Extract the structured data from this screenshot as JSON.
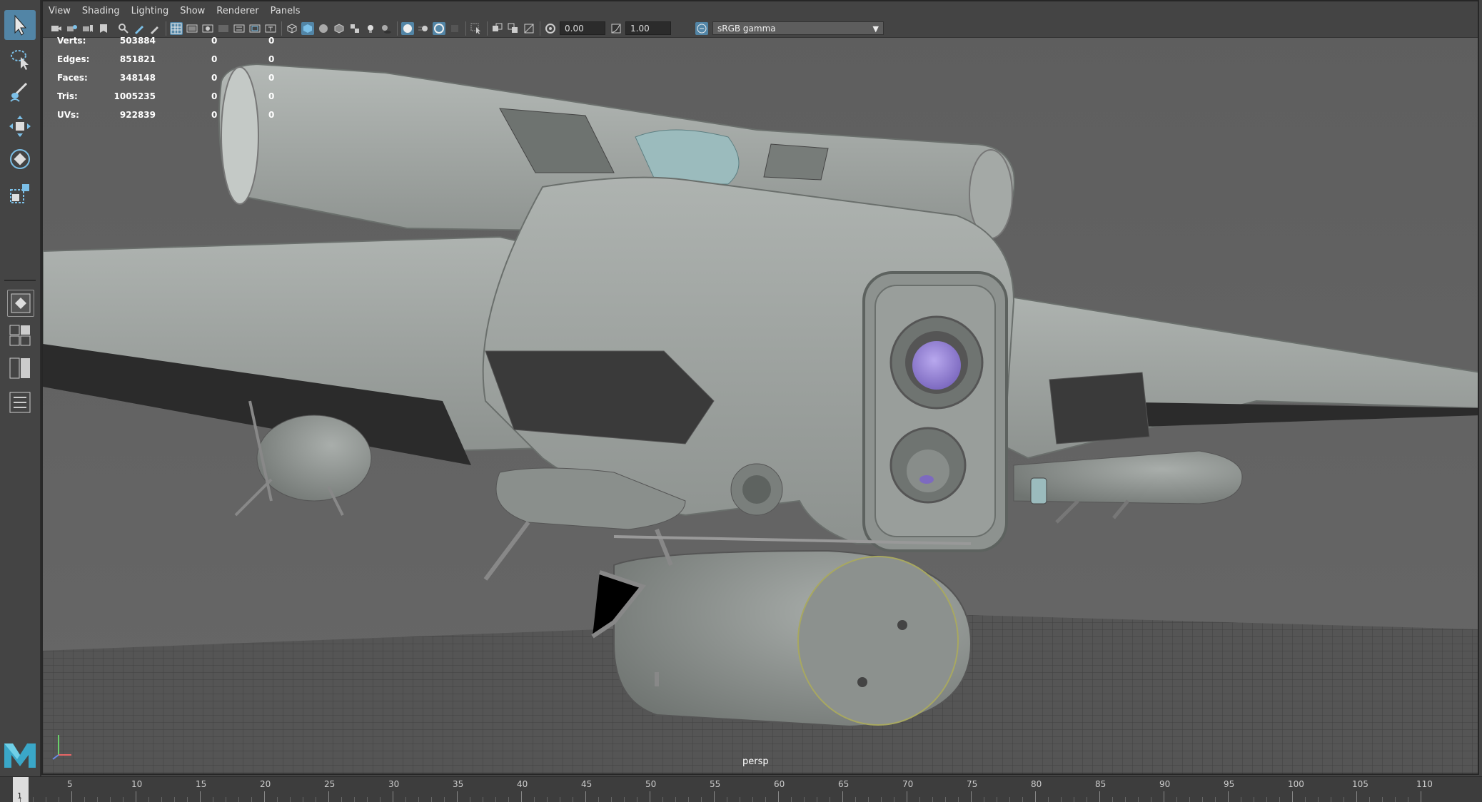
{
  "menu": [
    "View",
    "Shading",
    "Lighting",
    "Show",
    "Renderer",
    "Panels"
  ],
  "toolbar": {
    "exposure_value": "0.00",
    "gamma_value": "1.00",
    "color_space": "sRGB gamma"
  },
  "hud": [
    {
      "label": "Verts:",
      "v1": "503884",
      "v2": "0",
      "v3": "0"
    },
    {
      "label": "Edges:",
      "v1": "851821",
      "v2": "0",
      "v3": "0"
    },
    {
      "label": "Faces:",
      "v1": "348148",
      "v2": "0",
      "v3": "0"
    },
    {
      "label": "Tris:",
      "v1": "1005235",
      "v2": "0",
      "v3": "0"
    },
    {
      "label": "UVs:",
      "v1": "922839",
      "v2": "0",
      "v3": "0"
    }
  ],
  "camera_label": "persp",
  "timeline": {
    "current_frame": "1",
    "ticks": [
      "5",
      "10",
      "15",
      "20",
      "25",
      "30",
      "35",
      "40",
      "45",
      "50",
      "55",
      "60",
      "65",
      "70",
      "75",
      "80",
      "85",
      "90",
      "95",
      "100",
      "105",
      "110"
    ]
  },
  "icons": {
    "select_tool": "select-arrow-icon",
    "lasso_tool": "lasso-select-icon",
    "paint_tool": "paint-select-icon",
    "move_tool": "move-icon",
    "rotate_tool": "rotate-icon",
    "scale_tool": "scale-icon"
  },
  "colors": {
    "accent": "#5285a6",
    "viewport_bg": "#646464",
    "model_gray": "#9aa09c",
    "lens_purple": "#9a86d6"
  }
}
